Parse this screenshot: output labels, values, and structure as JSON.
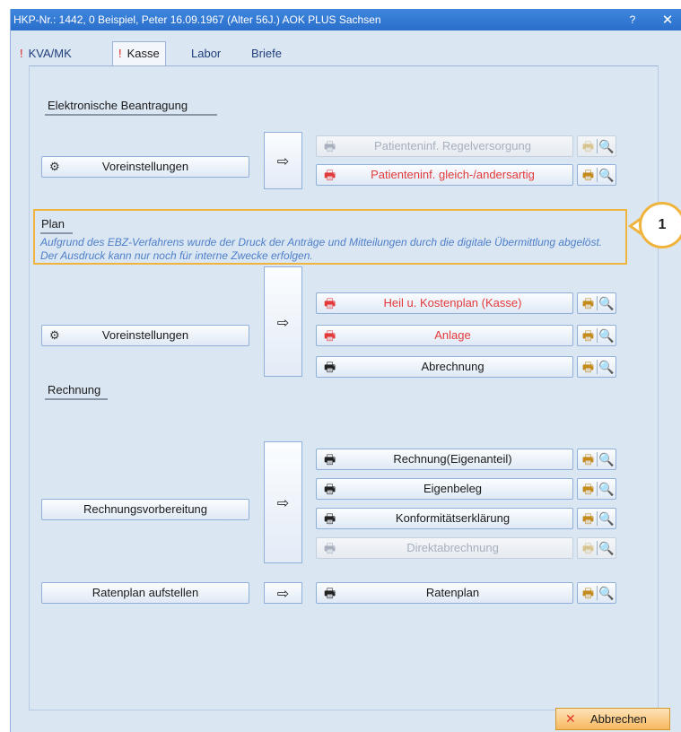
{
  "window": {
    "title": "HKP-Nr.: 1442, 0  Beispiel, Peter  16.09.1967 (Alter 56J.)  AOK PLUS Sachsen",
    "help": "?",
    "close": "✕"
  },
  "tabs": [
    {
      "label": "KVA/MK",
      "warn": "!"
    },
    {
      "label": "Kasse",
      "warn": "!"
    },
    {
      "label": "Labor"
    },
    {
      "label": "Briefe"
    }
  ],
  "electronic": {
    "title": "Elektronische Beantragung",
    "settings_label": "Voreinstellungen",
    "buttons": [
      {
        "label": "Patienteninf. Regelversorgung",
        "state": "disabled"
      },
      {
        "label": "Patienteninf. gleich-/andersartig",
        "state": "red"
      }
    ]
  },
  "plan": {
    "title": "Plan",
    "notice": "Aufgrund des EBZ-Verfahrens wurde der Druck der Anträge und Mitteilungen durch die digitale Übermittlung abgelöst. Der Ausdruck kann nur noch für interne Zwecke erfolgen.",
    "settings_label": "Voreinstellungen",
    "buttons": [
      {
        "label": "Heil u. Kostenplan (Kasse)",
        "state": "red"
      },
      {
        "label": "Anlage",
        "state": "red"
      },
      {
        "label": "Abrechnung",
        "state": "normal"
      }
    ]
  },
  "invoice": {
    "title": "Rechnung",
    "prep_label": "Rechnungsvorbereitung",
    "buttons": [
      {
        "label": "Rechnung(Eigenanteil)",
        "state": "normal"
      },
      {
        "label": "Eigenbeleg",
        "state": "normal"
      },
      {
        "label": "Konformitätserklärung",
        "state": "normal"
      },
      {
        "label": "Direktabrechnung",
        "state": "disabled"
      }
    ],
    "installment_label": "Ratenplan aufstellen",
    "installment_button": {
      "label": "Ratenplan",
      "state": "normal"
    }
  },
  "callout": {
    "number": "1"
  },
  "footer": {
    "cancel_label": "Abbrechen",
    "cancel_icon": "✕"
  },
  "icons": {
    "printer": "🖶",
    "preview": "🔍",
    "gear": "⚙",
    "arrow": "⇨"
  },
  "colors": {
    "accent": "#f0b43c",
    "red_text": "#e23a3a",
    "title_bar": "#2a6fcb",
    "notice_text": "#4d7fc8"
  }
}
